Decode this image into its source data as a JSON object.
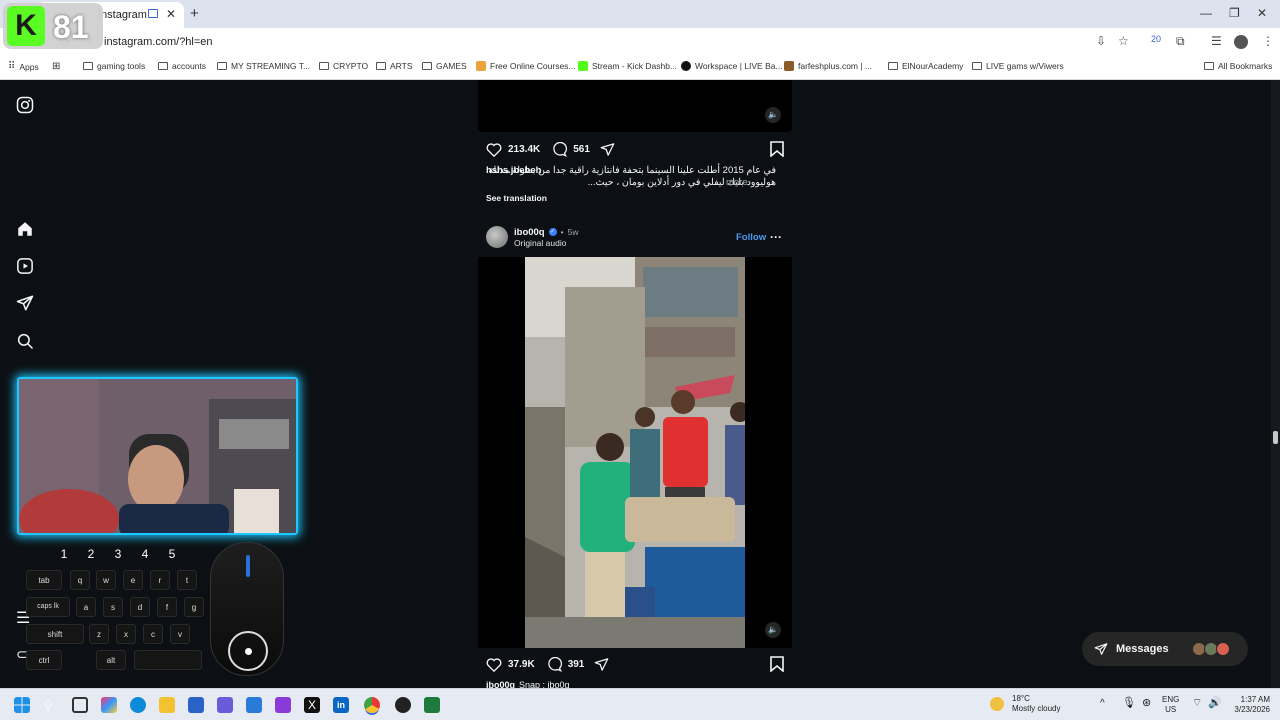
{
  "browser": {
    "tab_title": "Instagram",
    "url": "instagram.com/?hl=en",
    "bookmarks": [
      "Apps",
      "gaming tools",
      "accounts",
      "MY STREAMING T...",
      "CRYPTO",
      "ARTS",
      "GAMES",
      "Free Online Courses...",
      "Stream - Kick Dashb...",
      "Workspace | LIVE Ba...",
      "farfeshplus.com | ...",
      "ElNourAcademy",
      "LIVE gams w/Viwers"
    ],
    "all_bookmarks": "All Bookmarks",
    "ext_badge": "20"
  },
  "overlay": {
    "logo_number": "81",
    "number_keys": [
      "1",
      "2",
      "3",
      "4",
      "5"
    ],
    "keys": {
      "tab": "tab",
      "caps": "caps lk",
      "shift": "shift",
      "ctrl": "ctrl",
      "alt": "alt"
    },
    "letters_row1": [
      "q",
      "w",
      "e",
      "r",
      "t"
    ],
    "letters_row2": [
      "a",
      "s",
      "d",
      "f",
      "g"
    ],
    "letters_row3": [
      "z",
      "x",
      "c",
      "v"
    ]
  },
  "post1": {
    "likes": "213.4K",
    "comments": "561",
    "username": "hshs.jbeheh",
    "caption": "في عام 2015 أطلت علينا السينما بتحفة فانتازية راقية جدا من بطولة مدللة هوليوود بليك ليفلي في دور أدلاين بومان ، حيث...",
    "more": "more",
    "see_translation": "See translation"
  },
  "post2": {
    "username": "ibo00q",
    "time": "5w",
    "audio": "Original audio",
    "follow": "Follow",
    "likes": "37.9K",
    "comments": "391",
    "caption_user": "ibo00q",
    "caption_snip": "Snap : ibo0q"
  },
  "messages_label": "Messages",
  "taskbar": {
    "weather_temp": "18°C",
    "weather_desc": "Mostly cloudy",
    "lang1": "ENG",
    "lang2": "US",
    "time": "1:37 AM",
    "date": "3/23/2026"
  },
  "colors": {
    "accent": "#4a9bf0",
    "kick_green": "#53fc18",
    "cam_glow": "#1ec8ff"
  }
}
